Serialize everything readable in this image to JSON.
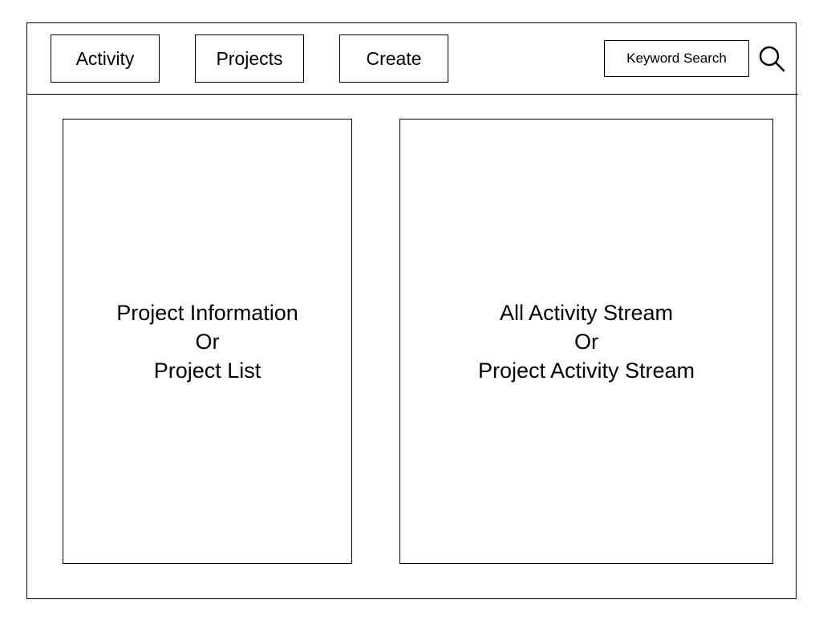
{
  "nav": {
    "activity": "Activity",
    "projects": "Projects",
    "create": "Create"
  },
  "search": {
    "label": "Keyword Search",
    "icon": "search-icon"
  },
  "left_panel": {
    "line1": "Project Information",
    "line2": "Or",
    "line3": "Project List"
  },
  "right_panel": {
    "line1": "All Activity Stream",
    "line2": "Or",
    "line3": "Project Activity Stream"
  }
}
